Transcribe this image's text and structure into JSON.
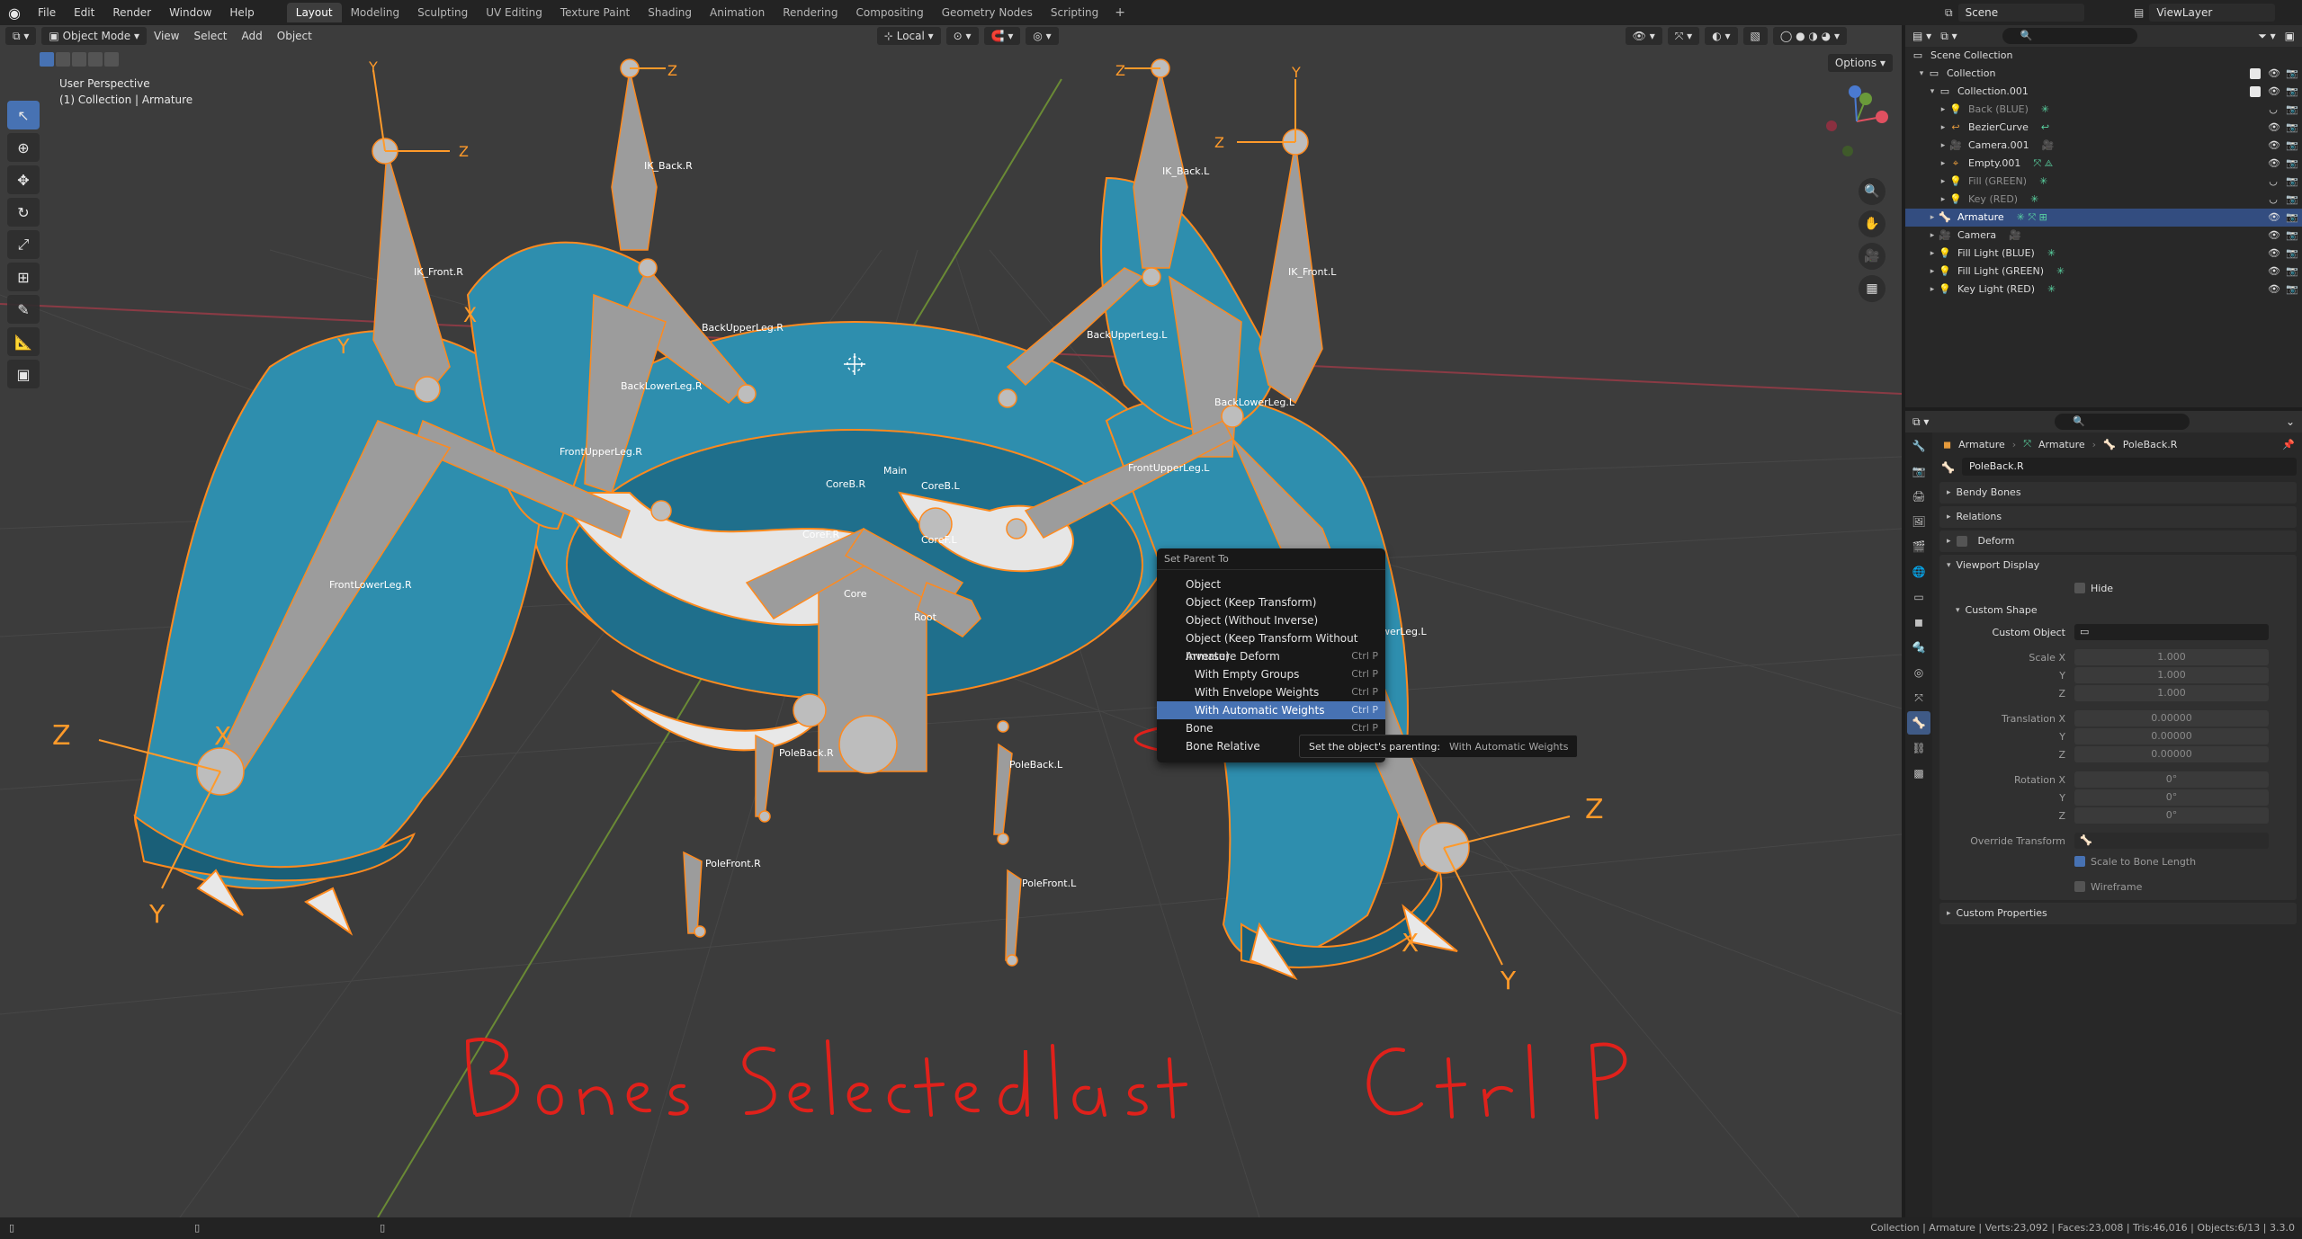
{
  "topbar": {
    "menus": [
      "File",
      "Edit",
      "Render",
      "Window",
      "Help"
    ],
    "workspaces": [
      "Layout",
      "Modeling",
      "Sculpting",
      "UV Editing",
      "Texture Paint",
      "Shading",
      "Animation",
      "Rendering",
      "Compositing",
      "Geometry Nodes",
      "Scripting"
    ],
    "add_tab": "+",
    "scene": "Scene",
    "view_layer": "ViewLayer"
  },
  "viewport_header": {
    "mode": "Object Mode",
    "menus": [
      "View",
      "Select",
      "Add",
      "Object"
    ],
    "transform_orientation": "Local",
    "options": "Options"
  },
  "viewport_info": {
    "perspective": "User Perspective",
    "context": "(1) Collection | Armature"
  },
  "bones": {
    "ik_back_r": "IK_Back.R",
    "ik_back_l": "IK_Back.L",
    "ik_front_r": "IK_Front.R",
    "ik_front_l": "IK_Front.L",
    "back_upper_leg_r": "BackUpperLeg.R",
    "back_upper_leg_l": "BackUpperLeg.L",
    "back_lower_leg_r": "BackLowerLeg.R",
    "back_lower_leg_l": "BackLowerLeg.L",
    "front_upper_leg_r": "FrontUpperLeg.R",
    "front_upper_leg_l": "FrontUpperLeg.L",
    "front_lower_leg_r": "FrontLowerLeg.R",
    "front_lower_leg_l": "werLeg.L",
    "main": "Main",
    "core_b_r": "CoreB.R",
    "core_b_l": "CoreB.L",
    "core_f_r": "CoreF.R",
    "core_f_l": "CoreF.L",
    "core": "Core",
    "root": "Root",
    "pole_back_r": "PoleBack.R",
    "pole_back_l": "PoleBack.L",
    "pole_front_r": "PoleFront.R",
    "pole_front_l": "PoleFront.L"
  },
  "axis_labels": {
    "x": "X",
    "y": "Y",
    "z": "Z"
  },
  "context_menu": {
    "title": "Set Parent To",
    "items": [
      {
        "label": "Object",
        "shortcut": ""
      },
      {
        "label": "Object (Keep Transform)",
        "shortcut": ""
      },
      {
        "label": "Object (Without Inverse)",
        "shortcut": ""
      },
      {
        "label": "Object (Keep Transform Without Inverse)",
        "shortcut": ""
      },
      {
        "label": "Armature Deform",
        "shortcut": "Ctrl P"
      },
      {
        "label": "With Empty Groups",
        "shortcut": "Ctrl P"
      },
      {
        "label": "With Envelope Weights",
        "shortcut": "Ctrl P"
      },
      {
        "label": "With Automatic Weights",
        "shortcut": "Ctrl P"
      },
      {
        "label": "Bone",
        "shortcut": "Ctrl P"
      },
      {
        "label": "Bone Relative",
        "shortcut": ""
      }
    ],
    "tooltip_label": "Set the object's parenting:",
    "tooltip_value": "With Automatic Weights"
  },
  "annotation": {
    "text": "Bones   Selected  last            Ctrl  P",
    "color": "#e0211b"
  },
  "outliner": {
    "root": "Scene Collection",
    "rows": [
      {
        "label": "Collection",
        "icon": "collection-icon"
      },
      {
        "label": "Collection.001",
        "icon": "collection-icon"
      },
      {
        "label": "Back (BLUE)",
        "icon": "light-icon"
      },
      {
        "label": "BezierCurve",
        "icon": "curve-icon"
      },
      {
        "label": "Camera.001",
        "icon": "camera-icon"
      },
      {
        "label": "Empty.001",
        "icon": "empty-icon"
      },
      {
        "label": "Fill (GREEN)",
        "icon": "light-icon"
      },
      {
        "label": "Key (RED)",
        "icon": "light-icon"
      },
      {
        "label": "Armature",
        "icon": "armature-icon"
      },
      {
        "label": "Camera",
        "icon": "camera-icon"
      },
      {
        "label": "Fill Light (BLUE)",
        "icon": "light-icon"
      },
      {
        "label": "Fill Light (GREEN)",
        "icon": "light-icon"
      },
      {
        "label": "Key Light (RED)",
        "icon": "light-icon"
      }
    ]
  },
  "properties": {
    "breadcrumb": [
      "Armature",
      "Armature",
      "PoleBack.R"
    ],
    "bone_name": "PoleBack.R",
    "sections": {
      "bendy_bones": "Bendy Bones",
      "relations": "Relations",
      "deform": "Deform",
      "viewport_display": "Viewport Display",
      "hide": "Hide",
      "custom_shape": "Custom Shape",
      "custom_object": "Custom Object",
      "scale_x": "Scale X",
      "axis_y": "Y",
      "axis_z": "Z",
      "scale_value": "1.000",
      "translation_x": "Translation X",
      "translation_value": "0.00000",
      "rotation_x": "Rotation X",
      "rotation_value": "0°",
      "override_transform": "Override Transform",
      "scale_to_bone_length": "Scale to Bone Length",
      "wireframe": "Wireframe",
      "custom_properties": "Custom Properties"
    }
  },
  "statusbar": {
    "stats": "Collection | Armature | Verts:23,092 | Faces:23,008 | Tris:46,016 | Objects:6/13 | 3.3.0"
  },
  "colors": {
    "accent": "#4772b3",
    "mesh": "#2f8fb0",
    "bone": "#9a9a9a",
    "selection": "#ff8a1e"
  }
}
